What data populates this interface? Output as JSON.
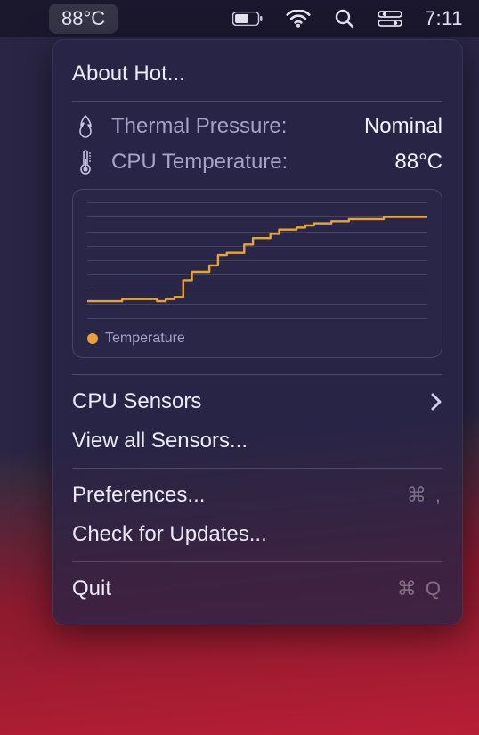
{
  "menubar": {
    "temperature": "88°C",
    "clock": "7:11"
  },
  "panel": {
    "about_label": "About Hot...",
    "thermal": {
      "label": "Thermal Pressure:",
      "value": "Nominal"
    },
    "cpu_temp": {
      "label": "CPU Temperature:",
      "value": "88°C"
    },
    "legend": {
      "temperature": "Temperature"
    },
    "menu": {
      "cpu_sensors": "CPU Sensors",
      "view_all_sensors": "View all Sensors...",
      "preferences": "Preferences...",
      "preferences_shortcut": "⌘  ,",
      "check_updates": "Check for Updates...",
      "quit": "Quit",
      "quit_shortcut": "⌘ Q"
    }
  },
  "chart_data": {
    "type": "line",
    "title": "",
    "xlabel": "",
    "ylabel": "",
    "ylim": [
      40,
      95
    ],
    "series": [
      {
        "name": "Temperature",
        "color": "#e8a431",
        "values": [
          48,
          48,
          48,
          48,
          49,
          49,
          49,
          49,
          48,
          49,
          50,
          58,
          62,
          62,
          65,
          70,
          71,
          71,
          75,
          78,
          78,
          80,
          82,
          82,
          83,
          84,
          85,
          85,
          86,
          86,
          87,
          87,
          87,
          87,
          88,
          88,
          88,
          88,
          88,
          88
        ]
      }
    ]
  }
}
